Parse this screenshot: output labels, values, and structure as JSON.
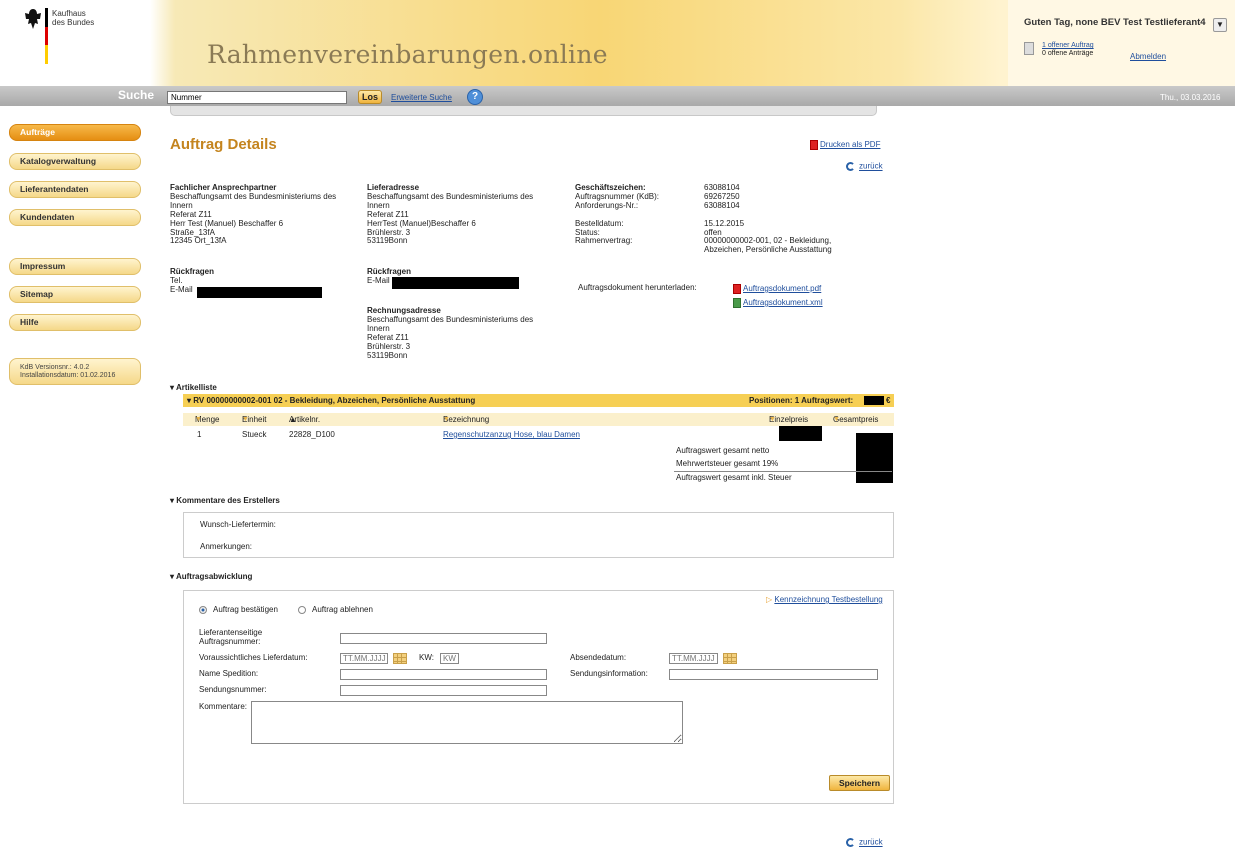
{
  "header": {
    "org_line1": "Kaufhaus",
    "org_line2": "des Bundes",
    "brand_title": "Rahmenvereinbarungen.online",
    "greeting": "Guten Tag, none BEV Test Testlieferant4",
    "open_orders_link": "1 offener Auftrag",
    "open_requests": "0 offene Anträge",
    "logout": "Abmelden"
  },
  "search": {
    "label": "Suche",
    "value": "Nummer",
    "go": "Los",
    "advanced": "Erweiterte Suche",
    "help": "?",
    "date": "Thu., 03.03.2016"
  },
  "nav": {
    "items": [
      "Aufträge",
      "Katalogverwaltung",
      "Lieferantendaten",
      "Kundendaten",
      "Impressum",
      "Sitemap",
      "Hilfe"
    ],
    "version_line1": "KdB Versionsnr.:   4.0.2",
    "version_line2": "Installationsdatum: 01.02.2016"
  },
  "page": {
    "title": "Auftrag Details",
    "print_pdf": "Drucken als PDF",
    "back": "zurück"
  },
  "contact": {
    "heading": "Fachlicher Ansprechpartner",
    "lines": [
      "Beschaffungsamt des Bundesministeriums des",
      "Innern",
      "Referat Z11",
      "Herr Test (Manuel) Beschaffer 6",
      "Straße_13fA",
      "12345 Ort_13fA"
    ],
    "queries_heading": "Rückfragen",
    "tel": "Tel.",
    "email": "E-Mail"
  },
  "delivery": {
    "heading": "Lieferadresse",
    "lines": [
      "Beschaffungsamt des Bundesministeriums des",
      "Innern",
      "Referat Z11",
      "HerrTest (Manuel)Beschaffer 6",
      "Brühlerstr. 3",
      "53119Bonn"
    ],
    "queries_heading": "Rückfragen",
    "email": "E-Mail",
    "billing_heading": "Rechnungsadresse",
    "billing_lines": [
      "Beschaffungsamt des Bundesministeriums des",
      "Innern",
      "Referat Z11",
      "Brühlerstr. 3",
      "53119Bonn"
    ]
  },
  "order": {
    "labels": [
      "Geschäftszeichen:",
      "Auftragsnummer (KdB):",
      "Anforderungs-Nr.:",
      "",
      "Bestelldatum:",
      "Status:",
      "Rahmenvertrag:"
    ],
    "values": [
      "63088104",
      "69267250",
      "63088104",
      "",
      "15.12.2015",
      "offen",
      "00000000002-001, 02 - Bekleidung,"
    ],
    "contract_line2": "Abzeichen, Persönliche Ausstattung",
    "doc_label": "Auftragsdokument herunterladen:",
    "doc_pdf": "Auftragsdokument.pdf",
    "doc_xml": "Auftragsdokument.xml"
  },
  "articles": {
    "section": "Artikelliste",
    "rv_title": "RV 00000000002-001 02 - Bekleidung, Abzeichen, Persönliche Ausstattung",
    "positions": "Positionen: 1 Auftragswert:",
    "currency": "€",
    "columns": [
      "Menge",
      "Einheit",
      "Artikelnr.",
      "Bezeichnung",
      "Einzelpreis",
      "Gesamtpreis"
    ],
    "row": {
      "qty": "1",
      "unit": "Stueck",
      "artno": "22828_D100",
      "desc": "Regenschutzanzug Hose, blau Damen"
    },
    "sum_net": "Auftragswert gesamt netto",
    "sum_vat": "Mehrwertsteuer gesamt 19%",
    "sum_gross": "Auftragswert gesamt inkl. Steuer"
  },
  "comments": {
    "section": "Kommentare des Erstellers",
    "wish_date": "Wunsch-Liefertermin:",
    "notes": "Anmerkungen:"
  },
  "processing": {
    "section": "Auftragsabwicklung",
    "confirm": "Auftrag bestätigen",
    "reject": "Auftrag ablehnen",
    "test_link": "Kennzeichnung Testbestellung",
    "supplier_no": [
      "Lieferantenseitige",
      "Auftragsnummer:"
    ],
    "exp_date": "Voraussichtliches Lieferdatum:",
    "date_ph": "TT.MM.JJJJ",
    "kw_label": "KW:",
    "kw_ph": "KW",
    "send_date": "Absendedatum:",
    "carrier": "Name Spedition:",
    "ship_info": "Sendungsinformation:",
    "tracking": "Sendungsnummer:",
    "comments": "Kommentare:",
    "save": "Speichern"
  }
}
